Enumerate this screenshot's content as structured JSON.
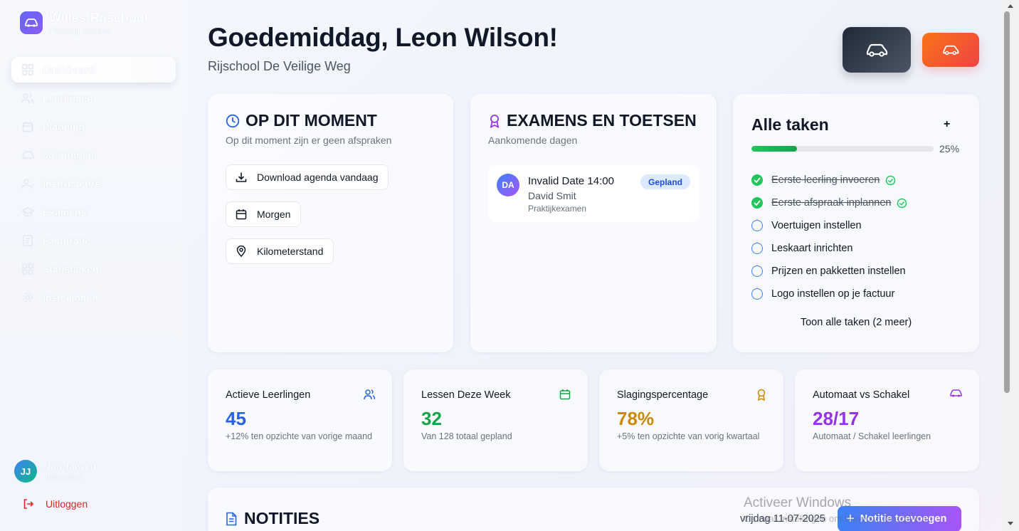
{
  "sidebar": {
    "brand_name": "Willes-Rijschool",
    "brand_sub": "Planning Systeem",
    "items": [
      {
        "label": "Dashboard",
        "icon": "grid-icon"
      },
      {
        "label": "Leerlingen",
        "icon": "users-icon"
      },
      {
        "label": "Planning",
        "icon": "calendar-icon"
      },
      {
        "label": "Voertuigen",
        "icon": "car-icon"
      },
      {
        "label": "Instructeurs",
        "icon": "user-check-icon"
      },
      {
        "label": "Examens",
        "icon": "graduation-cap-icon"
      },
      {
        "label": "Facturatie",
        "icon": "receipt-icon"
      },
      {
        "label": "Statistieken",
        "icon": "chart-grid-icon"
      },
      {
        "label": "Instellingen",
        "icon": "gear-icon"
      }
    ],
    "user": {
      "initials": "JJ",
      "name": "Jan Jansen",
      "role": "Instructeur"
    },
    "logout": "Uitloggen"
  },
  "header": {
    "greeting": "Goedemiddag, Leon Wilson!",
    "school": "Rijschool De Veilige Weg"
  },
  "now": {
    "title": "OP DIT MOMENT",
    "subtitle": "Op dit moment zijn er geen afspraken",
    "buttons": [
      "Download agenda vandaag",
      "Morgen",
      "Kilometerstand"
    ]
  },
  "exams": {
    "title": "EXAMENS EN TOETSEN",
    "subtitle": "Aankomende dagen",
    "item": {
      "initials": "DA",
      "date": "Invalid Date 14:00",
      "name": "David Smit",
      "type": "Praktijkexamen",
      "status": "Gepland"
    }
  },
  "tasks": {
    "title": "Alle taken",
    "add": "+",
    "progress_percent": 25,
    "progress_label": "25%",
    "items": [
      {
        "label": "Eerste leerling invoeren",
        "done": true
      },
      {
        "label": "Eerste afspraak inplannen",
        "done": true
      },
      {
        "label": "Voertuigen instellen",
        "done": false
      },
      {
        "label": "Leskaart inrichten",
        "done": false
      },
      {
        "label": "Prijzen en pakketten instellen",
        "done": false
      },
      {
        "label": "Logo instellen op je factuur",
        "done": false
      }
    ],
    "show_all": "Toon alle taken (2 meer)"
  },
  "stats": [
    {
      "title": "Actieve Leerlingen",
      "value": "45",
      "note": "+12% ten opzichte van vorige maand",
      "color": "#2563eb",
      "icon": "users-icon"
    },
    {
      "title": "Lessen Deze Week",
      "value": "32",
      "note": "Van 128 totaal gepland",
      "color": "#16a34a",
      "icon": "calendar-icon"
    },
    {
      "title": "Slagingspercentage",
      "value": "78%",
      "note": "+5% ten opzichte van vorig kwartaal",
      "color": "#ca8a04",
      "icon": "award-icon"
    },
    {
      "title": "Automaat vs Schakel",
      "value": "28/17",
      "note": "Automaat / Schakel leerlingen",
      "color": "#9333ea",
      "icon": "car-icon"
    }
  ],
  "notes": {
    "title": "NOTITIES",
    "date": "vrijdag 11-07-2025",
    "add_label": "Notitie toevoegen"
  },
  "watermark": {
    "line1": "Activeer Windows",
    "line2": "Ga naar Instellingen om Windows te activeren."
  }
}
